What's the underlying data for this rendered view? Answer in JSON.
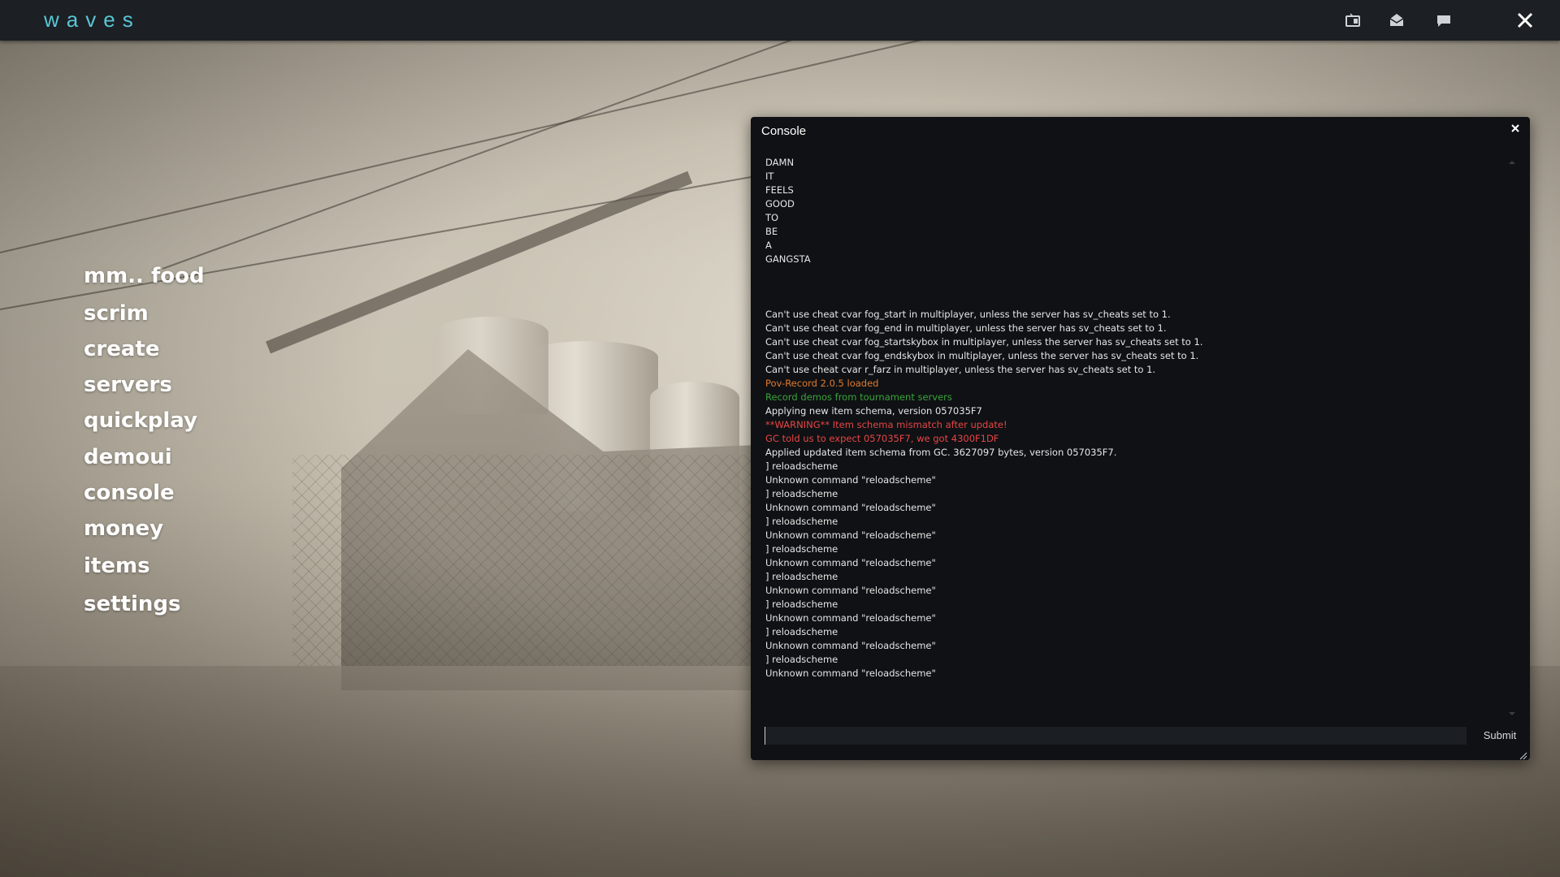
{
  "app": {
    "logo": "waves"
  },
  "topbar": {
    "icons": [
      "tv-icon",
      "mail-icon",
      "chat-icon",
      "close-icon"
    ]
  },
  "menu": {
    "items": [
      "mm.. food",
      "scrim",
      "create",
      "servers",
      "quickplay",
      "demoui",
      "console",
      "money",
      "items",
      "settings"
    ]
  },
  "console": {
    "title": "Console",
    "submit_label": "Submit",
    "input_value": "",
    "colors": {
      "default": "#e6e6e6",
      "orange": "#e07a2e",
      "green": "#3aa33a",
      "red": "#e84545"
    },
    "lines": [
      {
        "text": "DAMN",
        "color": "default"
      },
      {
        "text": "IT",
        "color": "default"
      },
      {
        "text": "FEELS",
        "color": "default"
      },
      {
        "text": "GOOD",
        "color": "default"
      },
      {
        "text": "TO",
        "color": "default"
      },
      {
        "text": "BE",
        "color": "default"
      },
      {
        "text": "A",
        "color": "default"
      },
      {
        "text": "GANGSTA",
        "color": "default"
      },
      {
        "text": "",
        "color": "default"
      },
      {
        "text": "",
        "color": "default"
      },
      {
        "text": "",
        "color": "default"
      },
      {
        "text": "Can't use cheat cvar fog_start in multiplayer, unless the server has sv_cheats set to 1.",
        "color": "default"
      },
      {
        "text": "Can't use cheat cvar fog_end in multiplayer, unless the server has sv_cheats set to 1.",
        "color": "default"
      },
      {
        "text": "Can't use cheat cvar fog_startskybox in multiplayer, unless the server has sv_cheats set to 1.",
        "color": "default"
      },
      {
        "text": "Can't use cheat cvar fog_endskybox in multiplayer, unless the server has sv_cheats set to 1.",
        "color": "default"
      },
      {
        "text": "Can't use cheat cvar r_farz in multiplayer, unless the server has sv_cheats set to 1.",
        "color": "default"
      },
      {
        "text": "Pov-Record 2.0.5 loaded",
        "color": "orange"
      },
      {
        "text": "Record demos from tournament servers",
        "color": "green"
      },
      {
        "text": "Applying new item schema, version 057035F7",
        "color": "default"
      },
      {
        "text": "**WARNING** Item schema mismatch after update!",
        "color": "red"
      },
      {
        "text": "GC told us to expect 057035F7, we got 4300F1DF",
        "color": "red"
      },
      {
        "text": "Applied updated item schema from GC. 3627097 bytes, version 057035F7.",
        "color": "default"
      },
      {
        "text": "] reloadscheme",
        "color": "default"
      },
      {
        "text": "Unknown command \"reloadscheme\"",
        "color": "default"
      },
      {
        "text": "] reloadscheme",
        "color": "default"
      },
      {
        "text": "Unknown command \"reloadscheme\"",
        "color": "default"
      },
      {
        "text": "] reloadscheme",
        "color": "default"
      },
      {
        "text": "Unknown command \"reloadscheme\"",
        "color": "default"
      },
      {
        "text": "] reloadscheme",
        "color": "default"
      },
      {
        "text": "Unknown command \"reloadscheme\"",
        "color": "default"
      },
      {
        "text": "] reloadscheme",
        "color": "default"
      },
      {
        "text": "Unknown command \"reloadscheme\"",
        "color": "default"
      },
      {
        "text": "] reloadscheme",
        "color": "default"
      },
      {
        "text": "Unknown command \"reloadscheme\"",
        "color": "default"
      },
      {
        "text": "] reloadscheme",
        "color": "default"
      },
      {
        "text": "Unknown command \"reloadscheme\"",
        "color": "default"
      },
      {
        "text": "] reloadscheme",
        "color": "default"
      },
      {
        "text": "Unknown command \"reloadscheme\"",
        "color": "default"
      }
    ]
  }
}
